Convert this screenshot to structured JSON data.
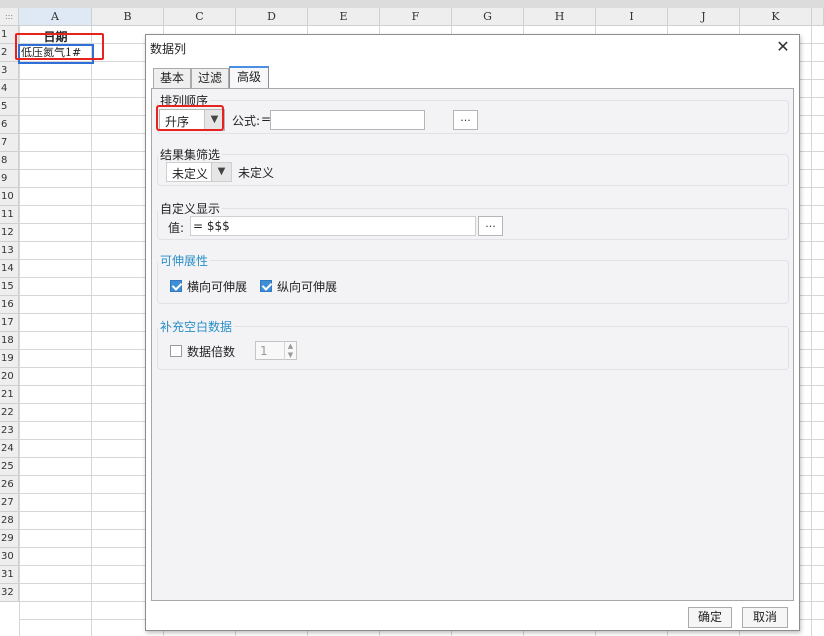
{
  "spreadsheet": {
    "corner_glyph": ":::",
    "columns": [
      "A",
      "B",
      "C",
      "D",
      "E",
      "F",
      "G",
      "H",
      "I",
      "J",
      "K"
    ],
    "rows": [
      "1",
      "2",
      "3",
      "4",
      "5",
      "6",
      "7",
      "8",
      "9",
      "10",
      "11",
      "12",
      "13",
      "14",
      "15",
      "16",
      "17",
      "18",
      "19",
      "20",
      "21",
      "22",
      "23",
      "24",
      "25",
      "26",
      "27",
      "28",
      "29",
      "30",
      "31",
      "32"
    ],
    "cell_a1": "日期",
    "cell_a2": "低压氮气1#"
  },
  "dialog": {
    "title": "数据列",
    "close_glyph": "✕",
    "tabs": [
      "基本",
      "过滤",
      "高级"
    ],
    "active_tab": "高级",
    "sort": {
      "title": "排列顺序",
      "selected": "升序",
      "formula_label": "公式:",
      "formula_value": "=",
      "dots": "..."
    },
    "filter": {
      "title": "结果集筛选",
      "selected": "未定义",
      "status": "未定义"
    },
    "custom_display": {
      "title": "自定义显示",
      "value_label": "值:",
      "value": "= $$$",
      "dots": "..."
    },
    "extensible": {
      "title": "可伸展性",
      "horizontal_label": "横向可伸展",
      "horizontal_checked": true,
      "vertical_label": "纵向可伸展",
      "vertical_checked": true
    },
    "fill_blank": {
      "title": "补充空白数据",
      "multiple_label": "数据倍数",
      "multiple_checked": false,
      "multiple_value": "1"
    },
    "ok_button": "确定",
    "cancel_button": "取消"
  },
  "colors": {
    "accent_blue": "#2a8fc6",
    "checkbox_blue": "#3f8ed8",
    "highlight_red": "#e8231f",
    "selection_blue": "#2f6fd8"
  },
  "icons": {
    "dropdown": "chevron-down-icon",
    "checkbox": "check-icon",
    "close": "close-icon"
  }
}
